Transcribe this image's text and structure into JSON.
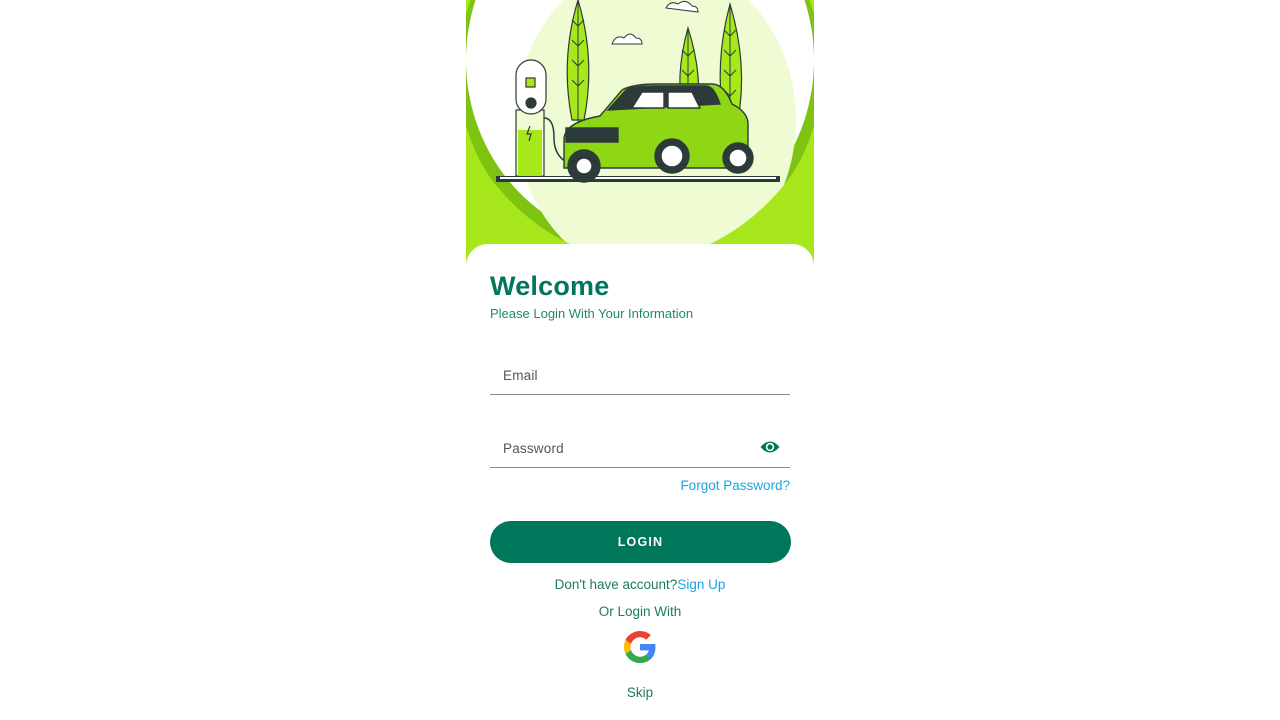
{
  "hero": {
    "illustration": "electric-car-charging-station"
  },
  "login": {
    "title": "Welcome",
    "subtitle": "Please Login With Your Information",
    "email_placeholder": "Email",
    "password_placeholder": "Password",
    "password_toggle_icon": "eye-icon",
    "forgot_password": "Forgot Password?",
    "login_button": "LOGIN",
    "no_account": "Don't have account?",
    "sign_up": "Sign Up",
    "or_login_with": "Or Login With",
    "google_icon": "google-icon",
    "skip": "Skip"
  },
  "colors": {
    "primary": "#00765a",
    "accent_green": "#a6e81a",
    "link": "#1aa4e0"
  }
}
